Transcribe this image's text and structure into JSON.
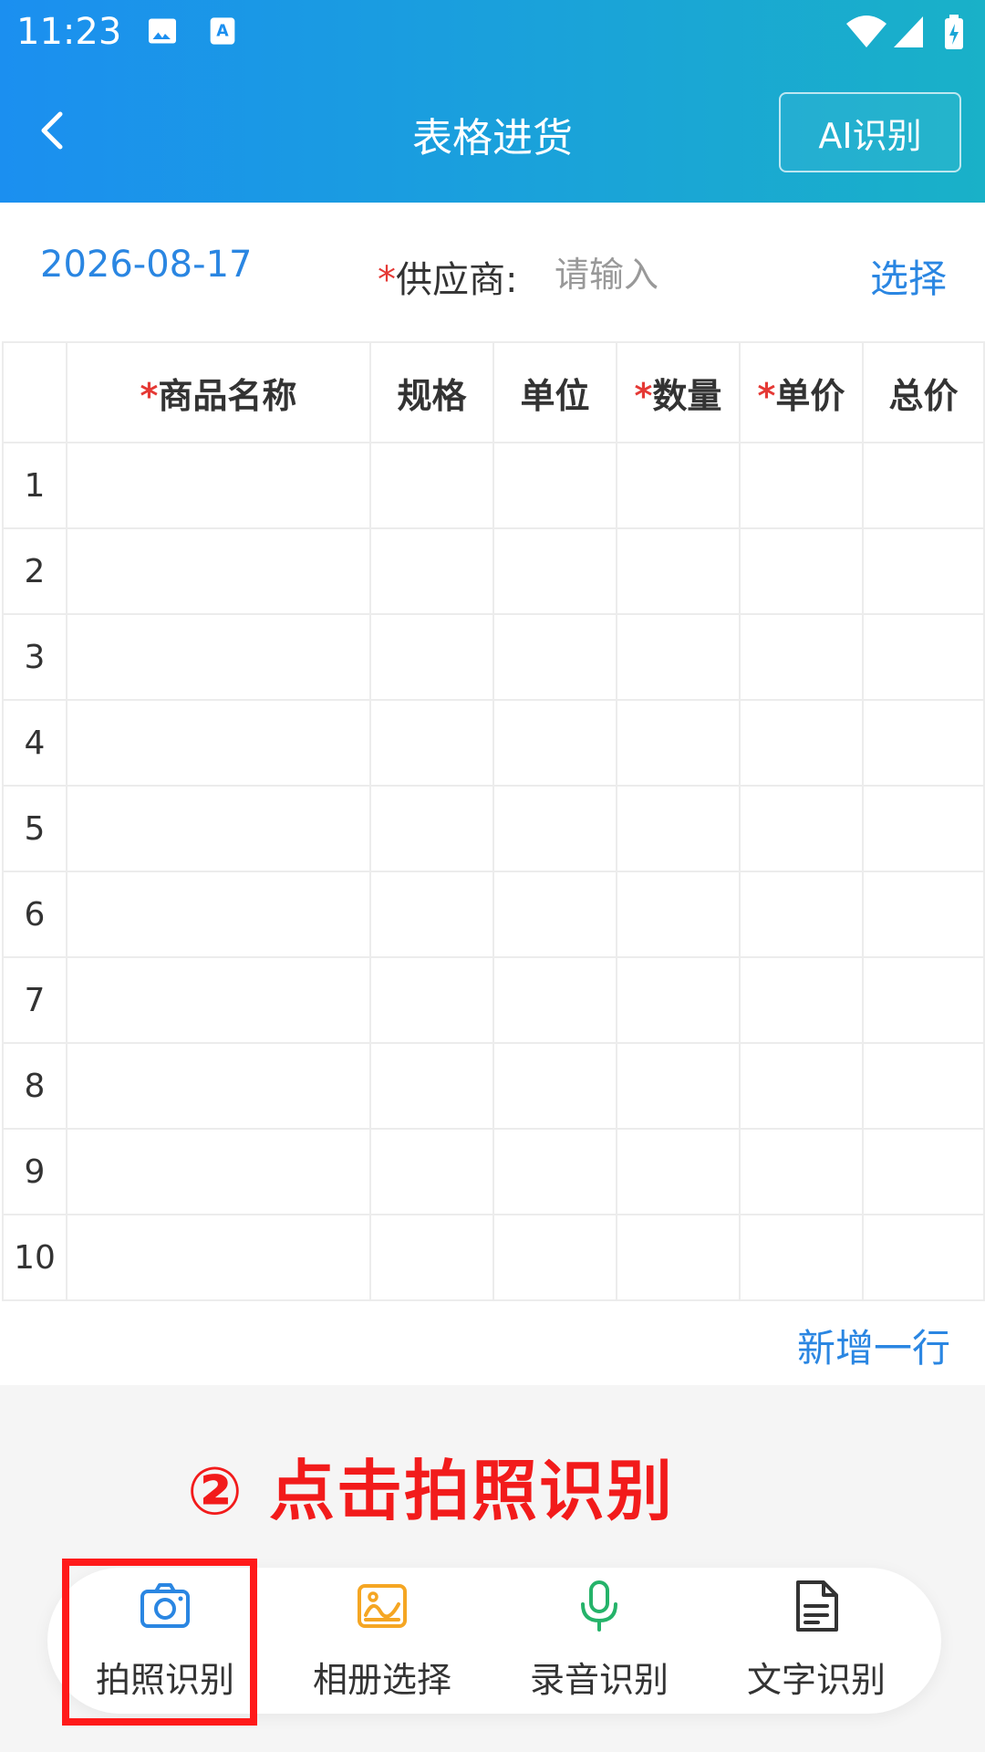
{
  "status_bar": {
    "time": "11:23"
  },
  "nav": {
    "title": "表格进货",
    "ai_button": "AI识别"
  },
  "form": {
    "date": "2026-08-17",
    "supplier_required": "*",
    "supplier_label": "供应商:",
    "supplier_placeholder": "请输入",
    "select_label": "选择"
  },
  "table": {
    "columns": [
      {
        "required": "*",
        "label": "商品名称"
      },
      {
        "required": "",
        "label": "规格"
      },
      {
        "required": "",
        "label": "单位"
      },
      {
        "required": "*",
        "label": "数量"
      },
      {
        "required": "*",
        "label": "单价"
      },
      {
        "required": "",
        "label": "总价"
      }
    ],
    "rows": [
      "1",
      "2",
      "3",
      "4",
      "5",
      "6",
      "7",
      "8",
      "9",
      "10"
    ]
  },
  "add_row_label": "新增一行",
  "hint_text": "② 点击拍照识别",
  "toolbar": {
    "items": [
      {
        "label": "拍照识别",
        "icon": "camera-icon",
        "color": "#2a86e2"
      },
      {
        "label": "相册选择",
        "icon": "album-icon",
        "color": "#f5a623"
      },
      {
        "label": "录音识别",
        "icon": "microphone-icon",
        "color": "#25b36a"
      },
      {
        "label": "文字识别",
        "icon": "document-icon",
        "color": "#333333"
      }
    ]
  }
}
